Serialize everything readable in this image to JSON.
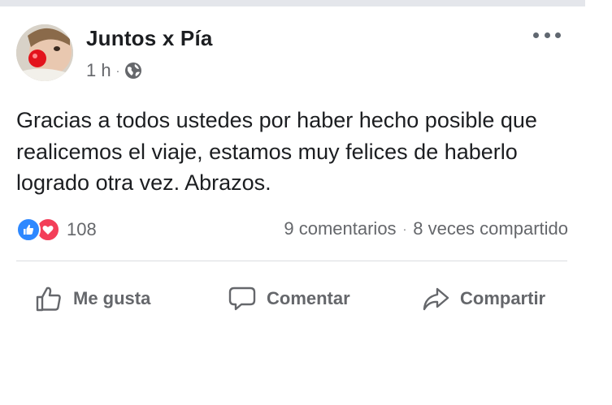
{
  "post": {
    "author": "Juntos x Pía",
    "time": "1 h",
    "meta_separator": "·",
    "privacy_icon": "globe-icon",
    "text": "Gracias a todos ustedes por haber hecho posible que realicemos el viaje, estamos muy felices de haberlo logrado otra vez. Abrazos.",
    "reactions": {
      "icons": [
        "like-reaction-icon",
        "love-reaction-icon"
      ],
      "count": "108"
    },
    "comments": "9 comentarios",
    "stats_separator": "·",
    "shares": "8 veces compartido"
  },
  "actions": {
    "like_label": "Me gusta",
    "comment_label": "Comentar",
    "share_label": "Compartir"
  },
  "colors": {
    "text_primary": "#1c1e21",
    "text_secondary": "#65676b",
    "like_blue": "#2d88ff",
    "love_red": "#f33e58",
    "divider": "#dadde1"
  }
}
